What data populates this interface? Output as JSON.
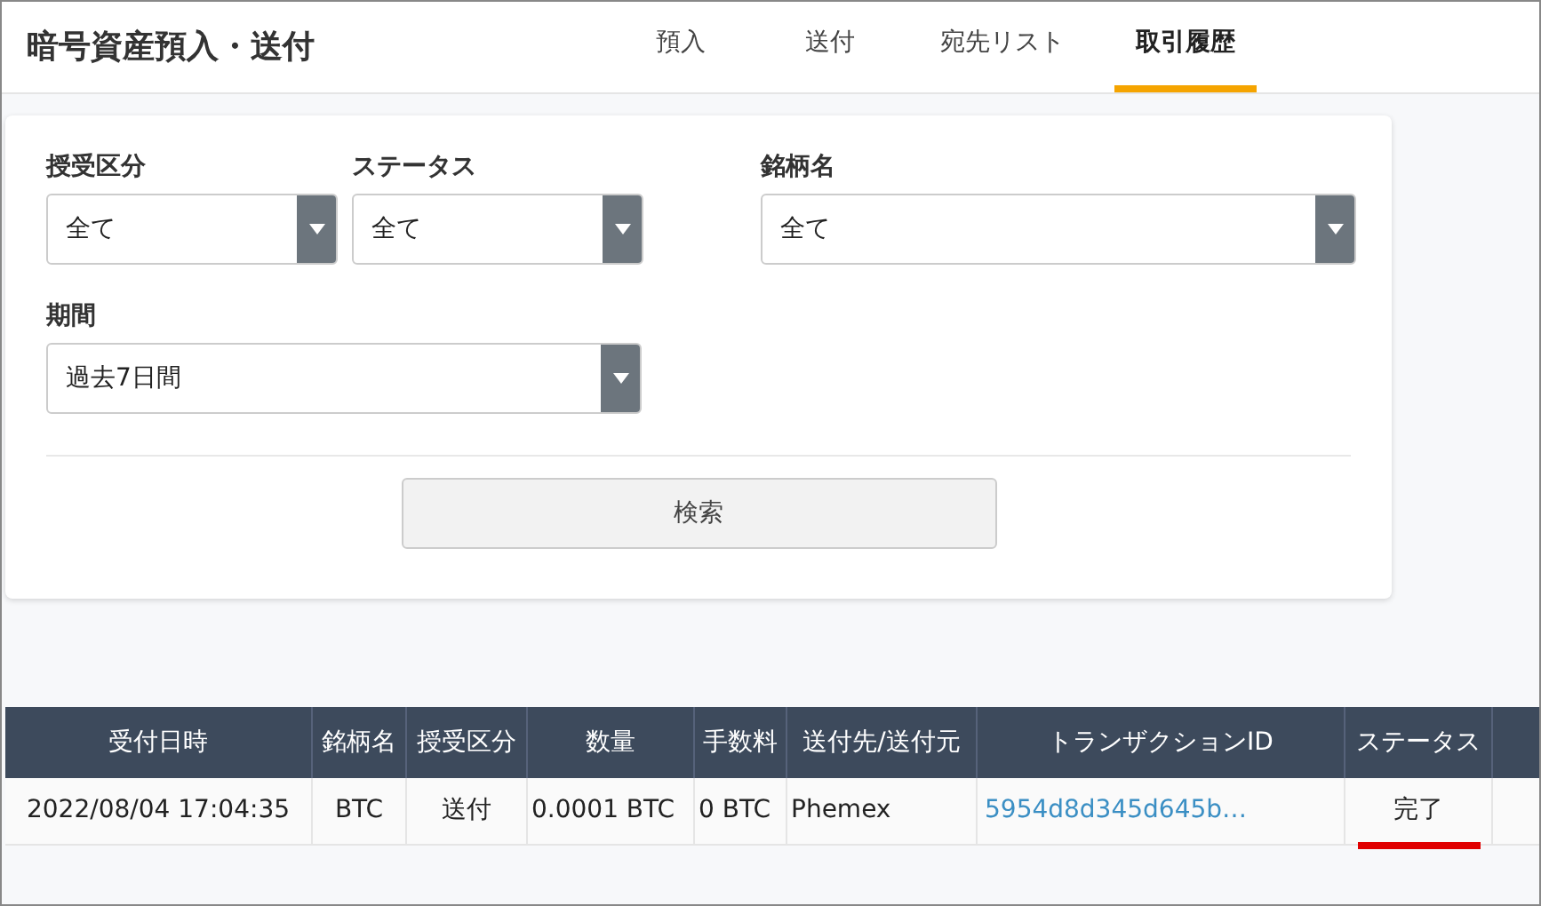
{
  "page_title": "暗号資産預入・送付",
  "tabs": [
    {
      "label": "預入",
      "selected": false
    },
    {
      "label": "送付",
      "selected": false
    },
    {
      "label": "宛先リスト",
      "selected": false
    },
    {
      "label": "取引履歴",
      "selected": true
    }
  ],
  "filters": [
    {
      "label": "授受区分",
      "value": "全て"
    },
    {
      "label": "ステータス",
      "value": "全て"
    },
    {
      "label": "銘柄名",
      "value": "全て"
    },
    {
      "label": "期間",
      "value": "過去7日間"
    }
  ],
  "search_button": "検索",
  "table": {
    "columns": [
      "受付日時",
      "銘柄名",
      "授受区分",
      "数量",
      "手数料",
      "送付先/送付元",
      "トランザクションID",
      "ステータス"
    ],
    "rows": [
      {
        "cells": [
          "2022/08/04 17:04:35",
          "BTC",
          "送付",
          "0.0001 BTC",
          "0 BTC",
          "Phemex",
          "5954d8d345d645b…",
          "完了"
        ],
        "status_underlined": true
      }
    ]
  }
}
